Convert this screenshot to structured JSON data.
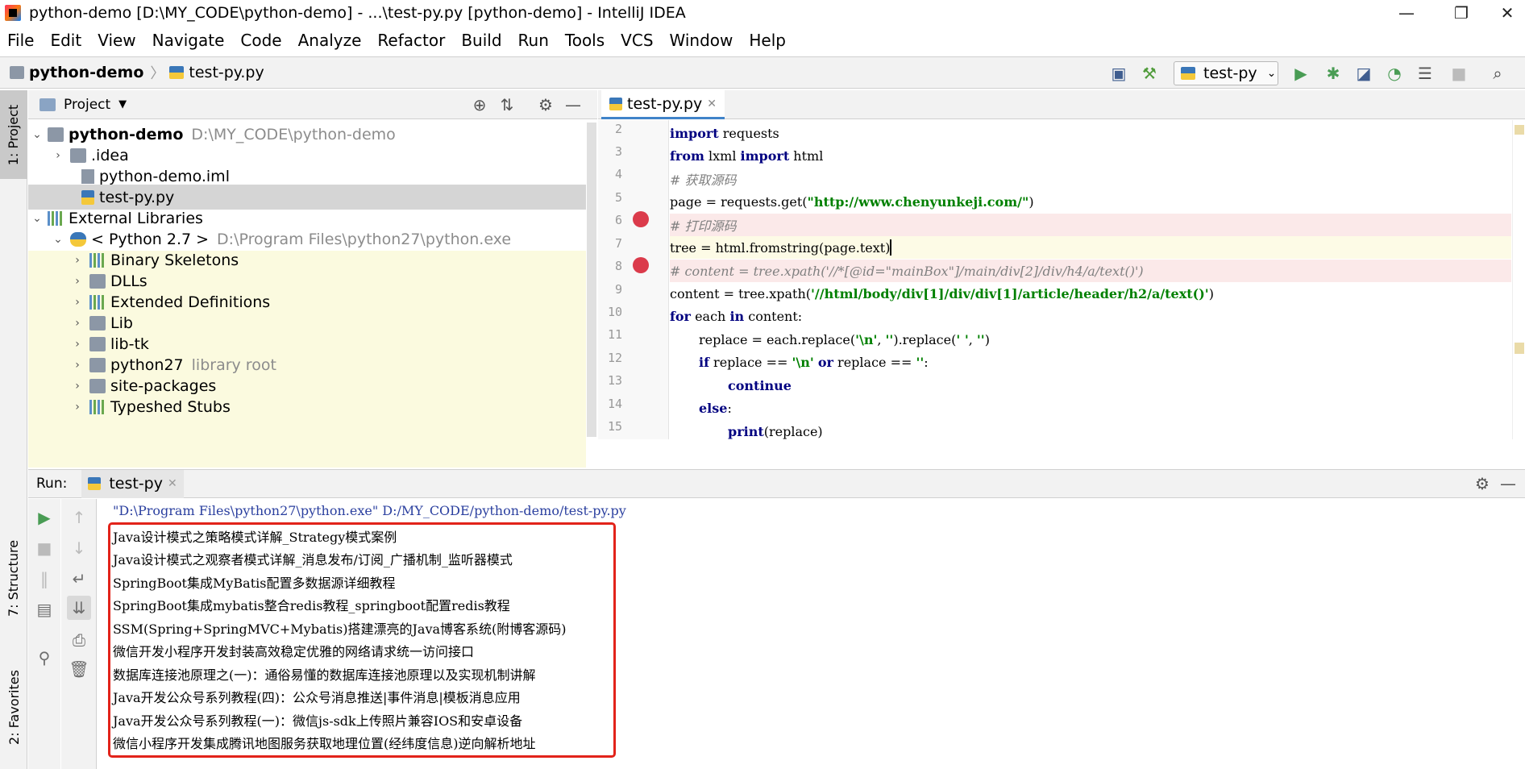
{
  "window": {
    "title": "python-demo [D:\\MY_CODE\\python-demo] - ...\\test-py.py [python-demo] - IntelliJ IDEA",
    "min": "—",
    "restore": "❐",
    "close": "✕"
  },
  "menu": [
    "File",
    "Edit",
    "View",
    "Navigate",
    "Code",
    "Analyze",
    "Refactor",
    "Build",
    "Run",
    "Tools",
    "VCS",
    "Window",
    "Help"
  ],
  "navbar": {
    "project": "python-demo",
    "file": "test-py.py",
    "run_config": "test-py"
  },
  "left_stripe": {
    "project_tab": "1: Project",
    "structure_tab": "7: Structure",
    "favorites_tab": "2: Favorites"
  },
  "project_panel": {
    "title": "Project"
  },
  "tree": [
    {
      "label": "python-demo",
      "sub": "D:\\MY_CODE\\python-demo"
    },
    {
      "label": ".idea",
      "sub": ""
    },
    {
      "label": "python-demo.iml",
      "sub": ""
    },
    {
      "label": "test-py.py",
      "sub": ""
    },
    {
      "label": "External Libraries",
      "sub": ""
    },
    {
      "label": "< Python 2.7 >",
      "sub": "D:\\Program Files\\python27\\python.exe"
    },
    {
      "label": "Binary Skeletons",
      "sub": ""
    },
    {
      "label": "DLLs",
      "sub": ""
    },
    {
      "label": "Extended Definitions",
      "sub": ""
    },
    {
      "label": "Lib",
      "sub": ""
    },
    {
      "label": "lib-tk",
      "sub": ""
    },
    {
      "label": "python27",
      "sub": "library root"
    },
    {
      "label": "site-packages",
      "sub": ""
    },
    {
      "label": "Typeshed Stubs",
      "sub": ""
    }
  ],
  "editor": {
    "tab": "test-py.py",
    "line_numbers": [
      "2",
      "3",
      "4",
      "5",
      "6",
      "7",
      "8",
      "9",
      "10",
      "11",
      "12",
      "13",
      "14",
      "15"
    ],
    "lines": {
      "l2": {
        "a": "import",
        "b": " requests"
      },
      "l3": {
        "a": "from",
        "b": " lxml ",
        "c": "import",
        "d": " html"
      },
      "l4": {
        "a": "# 获取源码"
      },
      "l5": {
        "a": "page = requests.get(",
        "b": "\"http://www.chenyunkeji.com/\"",
        "c": ")"
      },
      "l6": {
        "a": "# 打印源码"
      },
      "l7": {
        "a": "tree = html.fromstring(page.text)"
      },
      "l8": {
        "a": "# content = tree.xpath('//*[@id=\"mainBox\"]/main/div[2]/div/h4/a/text()')"
      },
      "l9": {
        "a": "content = tree.xpath(",
        "b": "'//html/body/div[1]/div/div[1]/article/header/h2/a/text()'",
        "c": ")"
      },
      "l10": {
        "a": "for",
        "b": " each ",
        "c": "in",
        "d": " content:"
      },
      "l11": {
        "a": "replace = each.replace(",
        "b": "'\\n'",
        "c": ", ",
        "d": "''",
        "e": ").replace(",
        "f": "' '",
        "g": ", ",
        "h": "''",
        "i": ")"
      },
      "l12": {
        "a": "if",
        "b": " replace == ",
        "c": "'\\n'",
        "d": " ",
        "e": "or",
        "f": " replace == ",
        "g": "''",
        "h": ":"
      },
      "l13": {
        "a": "continue"
      },
      "l14": {
        "a": "else",
        "b": ":"
      },
      "l15": {
        "a": "print",
        "b": "(replace)"
      }
    }
  },
  "run": {
    "label": "Run:",
    "tab": "test-py",
    "command": "\"D:\\Program Files\\python27\\python.exe\" D:/MY_CODE/python-demo/test-py.py",
    "output": [
      "Java设计模式之策略模式详解_Strategy模式案例",
      "Java设计模式之观察者模式详解_消息发布/订阅_广播机制_监听器模式",
      "SpringBoot集成MyBatis配置多数据源详细教程",
      "SpringBoot集成mybatis整合redis教程_springboot配置redis教程",
      "SSM(Spring+SpringMVC+Mybatis)搭建漂亮的Java博客系统(附博客源码)",
      "微信开发小程序开发封装高效稳定优雅的网络请求统一访问接口",
      "数据库连接池原理之(一)：通俗易懂的数据库连接池原理以及实现机制讲解",
      "Java开发公众号系列教程(四)：公众号消息推送|事件消息|模板消息应用",
      "Java开发公众号系列教程(一)：微信js-sdk上传照片兼容IOS和安卓设备",
      "微信小程序开发集成腾讯地图服务获取地理位置(经纬度信息)逆向解析地址"
    ]
  },
  "colors": {
    "keyword": "#000080",
    "string": "#008000",
    "comment": "#808080",
    "breakpoint": "#db3b4b",
    "highlight_box": "#e2231a",
    "console_cmd": "#2a3f9f"
  }
}
